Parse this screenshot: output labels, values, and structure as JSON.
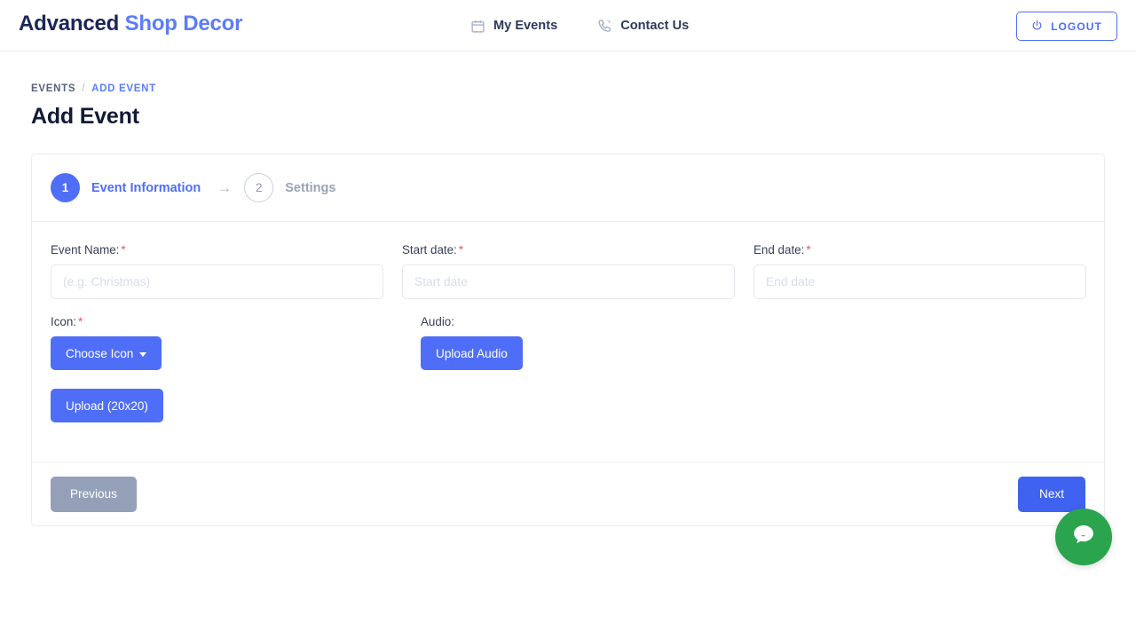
{
  "header": {
    "brand_strong": "Advanced",
    "brand_light": "Shop Decor",
    "nav": [
      {
        "label": "My Events",
        "icon": "calendar-icon"
      },
      {
        "label": "Contact Us",
        "icon": "phone-icon"
      }
    ],
    "logout_label": "LOGOUT",
    "logout_icon": "power-icon"
  },
  "breadcrumb": {
    "root": "EVENTS",
    "separator": "/",
    "current": "ADD EVENT"
  },
  "page_title": "Add Event",
  "stepper": {
    "steps": [
      {
        "number": "1",
        "label": "Event Information",
        "state": "active"
      },
      {
        "number": "2",
        "label": "Settings",
        "state": "inactive"
      }
    ],
    "arrow": "→"
  },
  "form": {
    "event_name": {
      "label": "Event Name:",
      "required": "*",
      "value": "",
      "placeholder": "(e.g. Christmas)"
    },
    "start_date": {
      "label": "Start date:",
      "required": "*",
      "value": "",
      "placeholder": "Start date"
    },
    "end_date": {
      "label": "End date:",
      "required": "*",
      "value": "",
      "placeholder": "End date"
    },
    "icon": {
      "label": "Icon:",
      "required": "*",
      "button_label": "Choose Icon"
    },
    "audio": {
      "label": "Audio:",
      "button_label": "Upload Audio"
    },
    "upload_button_label": "Upload (20x20)"
  },
  "footer": {
    "previous_label": "Previous",
    "next_label": "Next"
  },
  "chat": {
    "icon": "chat-bubble-icon"
  },
  "colors": {
    "accent_blue": "#4f6ef7",
    "brand_dark": "#1b2559",
    "brand_light": "#5c7cfa",
    "required_red": "#f0506e",
    "disabled_gray": "#94a0b8",
    "chat_green": "#2ba44e",
    "border": "#e9ebf3"
  }
}
